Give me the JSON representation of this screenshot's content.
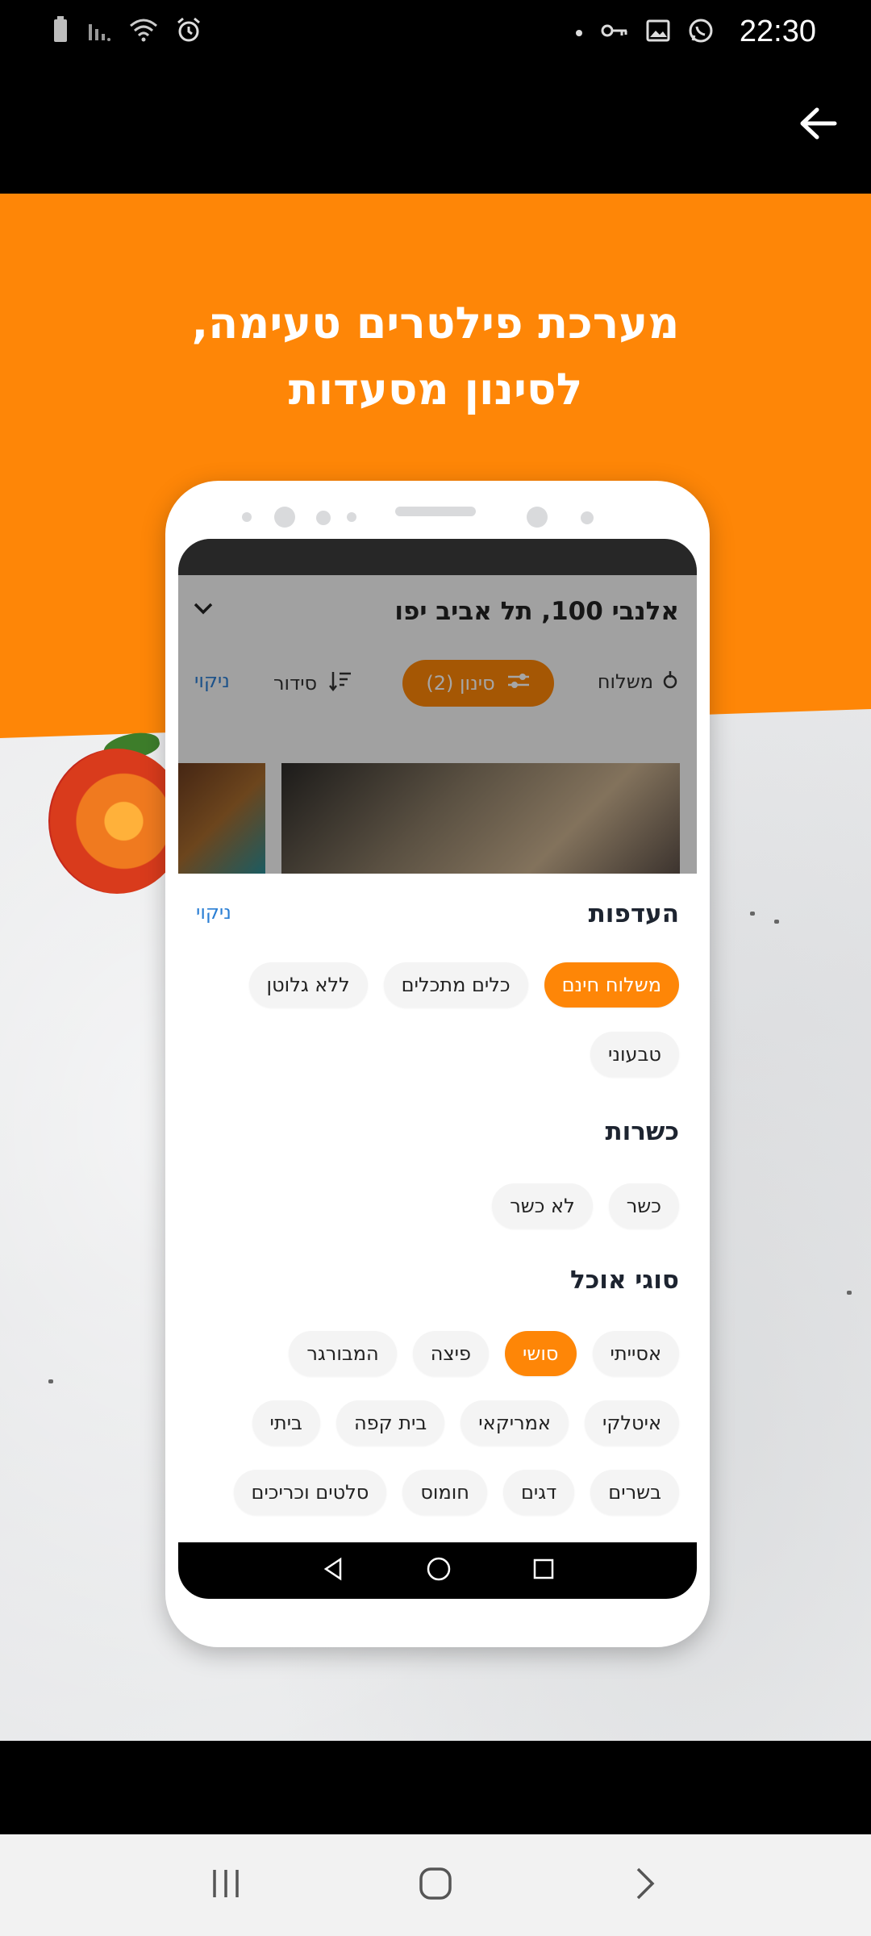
{
  "status_bar": {
    "time": "22:30"
  },
  "promo": {
    "headline_line1": "מערכת פילטרים טעימה,",
    "headline_line2": "לסינון מסעדות"
  },
  "phone_screen": {
    "address": "אלנבי 100, תל אביב יפו",
    "toolbar": {
      "delivery": "משלוח",
      "filter": "סינון (2)",
      "sort": "סידור",
      "clear": "ניקוי"
    },
    "sheet": {
      "clear": "ניקוי",
      "sections": [
        {
          "title": "העדפות",
          "chips": [
            {
              "label": "משלוח חינם",
              "selected": true
            },
            {
              "label": "כלים מתכלים",
              "selected": false
            },
            {
              "label": "ללא גלוטן",
              "selected": false
            },
            {
              "label": "טבעוני",
              "selected": false
            }
          ]
        },
        {
          "title": "כשרות",
          "chips": [
            {
              "label": "כשר",
              "selected": false
            },
            {
              "label": "לא כשר",
              "selected": false
            }
          ]
        },
        {
          "title": "סוגי אוכל",
          "chips": [
            {
              "label": "אסייתי",
              "selected": false
            },
            {
              "label": "סושי",
              "selected": true
            },
            {
              "label": "פיצה",
              "selected": false
            },
            {
              "label": "המבורגר",
              "selected": false
            },
            {
              "label": "איטלקי",
              "selected": false
            },
            {
              "label": "אמריקאי",
              "selected": false
            },
            {
              "label": "בית קפה",
              "selected": false
            },
            {
              "label": "ביתי",
              "selected": false
            },
            {
              "label": "בשרים",
              "selected": false
            },
            {
              "label": "דגים",
              "selected": false
            },
            {
              "label": "חומוס",
              "selected": false
            },
            {
              "label": "סלטים וכריכים",
              "selected": false
            }
          ]
        }
      ]
    }
  },
  "colors": {
    "accent": "#fe8607",
    "link": "#2b7fd4"
  }
}
